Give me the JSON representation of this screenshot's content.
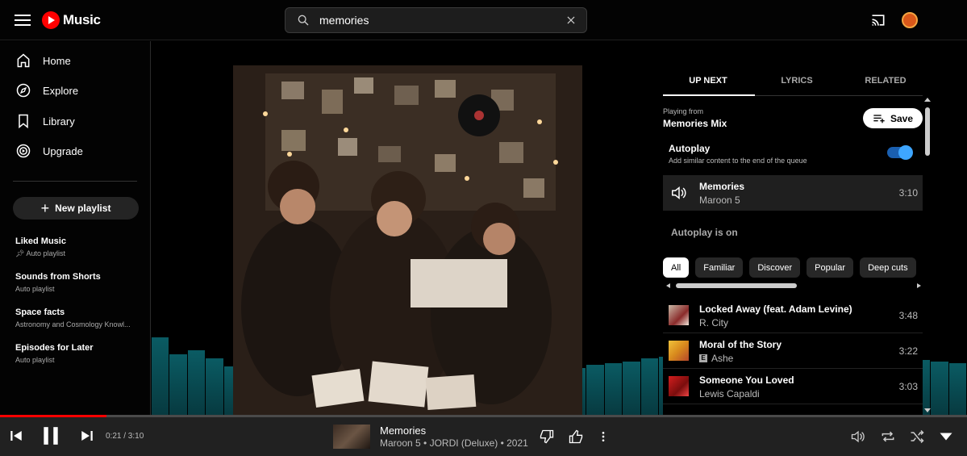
{
  "header": {
    "logo_text": "Music",
    "search": {
      "value": "memories",
      "placeholder": "Search"
    }
  },
  "sidebar": {
    "nav": [
      {
        "label": "Home",
        "icon": "home-icon"
      },
      {
        "label": "Explore",
        "icon": "explore-icon"
      },
      {
        "label": "Library",
        "icon": "library-icon"
      },
      {
        "label": "Upgrade",
        "icon": "upgrade-icon"
      }
    ],
    "new_playlist_label": "New playlist",
    "playlists": [
      {
        "title": "Liked Music",
        "subtitle": "Auto playlist",
        "pinned": true
      },
      {
        "title": "Sounds from Shorts",
        "subtitle": "Auto playlist"
      },
      {
        "title": "Space facts",
        "subtitle": "Astronomy and Cosmology Knowl..."
      },
      {
        "title": "Episodes for Later",
        "subtitle": "Auto playlist"
      }
    ]
  },
  "panel": {
    "tabs": [
      "UP NEXT",
      "LYRICS",
      "RELATED"
    ],
    "active_tab": "UP NEXT",
    "playing_from_label": "Playing from",
    "mix_name": "Memories Mix",
    "save_label": "Save",
    "autoplay_title": "Autoplay",
    "autoplay_desc": "Add similar content to the end of the queue",
    "autoplay_enabled": true,
    "current_track": {
      "title": "Memories",
      "artist": "Maroon 5",
      "duration": "3:10"
    },
    "autoplay_on_label": "Autoplay is on",
    "chips": [
      "All",
      "Familiar",
      "Discover",
      "Popular",
      "Deep cuts"
    ],
    "active_chip": "All",
    "queue": [
      {
        "title": "Locked Away (feat. Adam Levine)",
        "artist": "R. City",
        "duration": "3:48",
        "explicit": false
      },
      {
        "title": "Moral of the Story",
        "artist": "Ashe",
        "duration": "3:22",
        "explicit": true
      },
      {
        "title": "Someone You Loved",
        "artist": "Lewis Capaldi",
        "duration": "3:03",
        "explicit": false
      }
    ]
  },
  "player": {
    "elapsed": "0:21 / 3:10",
    "progress_fraction": 0.11,
    "title": "Memories",
    "subtitle": "Maroon 5 • JORDI (Deluxe) • 2021"
  },
  "colors": {
    "accent": "#ff0000",
    "toggle": "#3ea6ff",
    "visualizer": "#0a5b63"
  }
}
